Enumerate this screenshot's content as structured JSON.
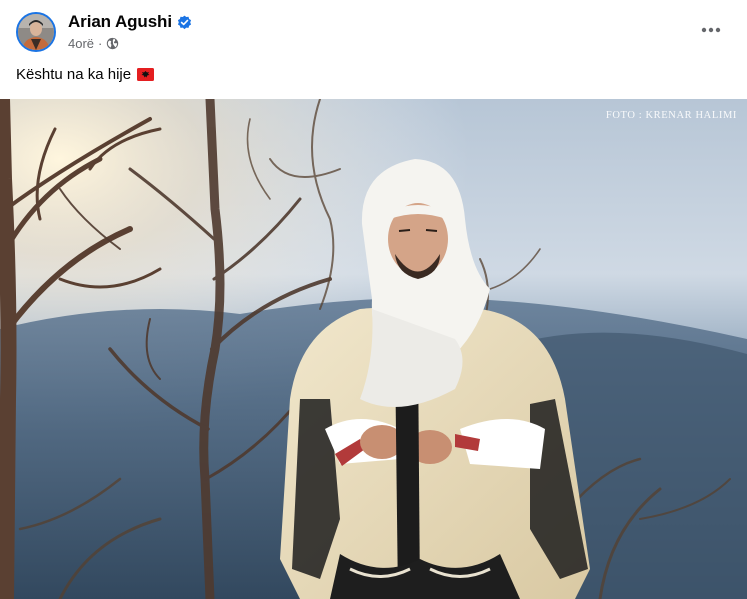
{
  "post": {
    "author": {
      "name": "Arian Agushi",
      "verified": true,
      "avatar_icon": "profile-photo"
    },
    "timestamp": "4orë",
    "separator": "·",
    "audience_icon": "globe-icon",
    "more_icon": "more-horizontal-icon",
    "caption": "Kështu na ka hije",
    "caption_emoji": "albania-flag-icon",
    "photo": {
      "credit": "FOTO : KRENAR HALIMI"
    }
  },
  "colors": {
    "brand_blue": "#1b74e4",
    "text_primary": "#050505",
    "text_secondary": "#65676b",
    "flag_red": "#e41e20"
  }
}
